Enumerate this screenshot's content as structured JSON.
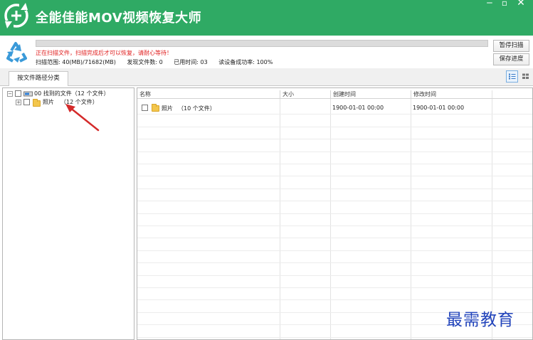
{
  "app": {
    "title": "全能佳能MOV视频恢复大师",
    "accent_color": "#2faa64",
    "logo_icon": "recovery-plus-icon"
  },
  "window_controls": {
    "minimize": "‒",
    "maximize": "▫",
    "close": "✕"
  },
  "scan": {
    "progress_fraction": 0,
    "notice": "正在扫描文件，扫描完成后才可以恢复，请耐心等待！",
    "range": "扫描范围: 40(MB)/71682(MB)",
    "found": "发现文件数: 0",
    "elapsed": "已用时间: 03",
    "read_rate": "读设备成功率: 100%",
    "pause_button": "暂停扫描",
    "save_button": "保存进度"
  },
  "tabs": {
    "path_category": "按文件路径分类"
  },
  "tree": {
    "root_label": "00 找到的文件（12 个文件）",
    "child_name": "照片",
    "child_count": "（12 个文件）"
  },
  "table": {
    "columns": {
      "name": "名称",
      "size": "大小",
      "created": "创建时间",
      "modified": "修改时间"
    },
    "rows": [
      {
        "name": "照片",
        "count": "（10 个文件）",
        "size": "",
        "created": "1900-01-01 00:00",
        "modified": "1900-01-01 00:00"
      }
    ]
  },
  "watermark": "最需教育"
}
